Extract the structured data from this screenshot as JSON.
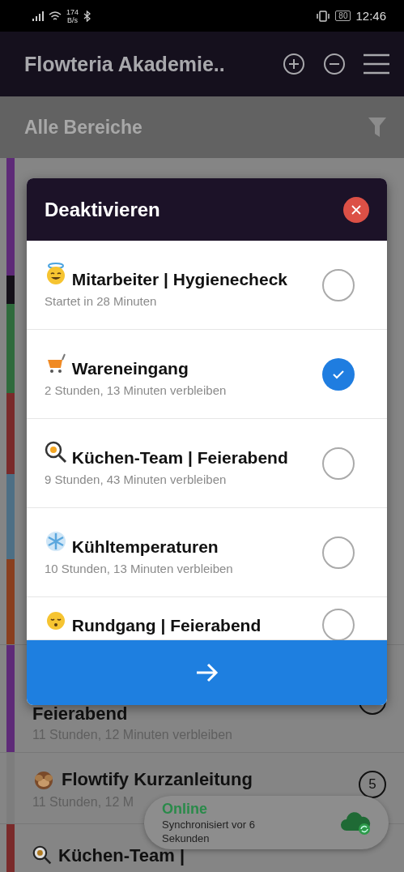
{
  "status_bar": {
    "net_speed": "174",
    "net_unit": "B/s",
    "battery": "80",
    "time": "12:46"
  },
  "app_bar": {
    "title": "Flowteria Akademie.."
  },
  "filter": {
    "label": "Alle Bereiche"
  },
  "background_list": {
    "stripes": [
      {
        "color": "#5e2a78"
      },
      {
        "color": "#141018"
      },
      {
        "color": "#2f6b3c"
      },
      {
        "color": "#7a2a2a"
      },
      {
        "color": "#4d6f85"
      },
      {
        "color": "#8a3f1e"
      }
    ],
    "rows": [
      {
        "title": "Feierabend",
        "subtitle": "11 Stunden, 12 Minuten verbleiben",
        "color": "#5e2a78"
      },
      {
        "title": "Flowtify Kurzanleitung",
        "subtitle": "11 Stunden, 12 M",
        "count": "5",
        "color": "#7d7d7d"
      },
      {
        "title": "Küchen-Team |",
        "color": "#7a2a2a"
      }
    ]
  },
  "dialog": {
    "title": "Deaktivieren",
    "items": [
      {
        "title": "Mitarbeiter | Hygienecheck",
        "subtitle": "Startet in 28 Minuten",
        "checked": false
      },
      {
        "title": "Wareneingang",
        "subtitle": "2 Stunden, 13 Minuten verbleiben",
        "checked": true
      },
      {
        "title": "Küchen-Team | Feierabend",
        "subtitle": "9 Stunden, 43 Minuten verbleiben",
        "checked": false
      },
      {
        "title": "Kühltemperaturen",
        "subtitle": "10 Stunden, 13 Minuten verbleiben",
        "checked": false
      },
      {
        "title": "Rundgang | Feierabend",
        "checked": false
      }
    ]
  },
  "toast": {
    "status": "Online",
    "message": "Synchronisiert vor 6 Sekunden"
  }
}
